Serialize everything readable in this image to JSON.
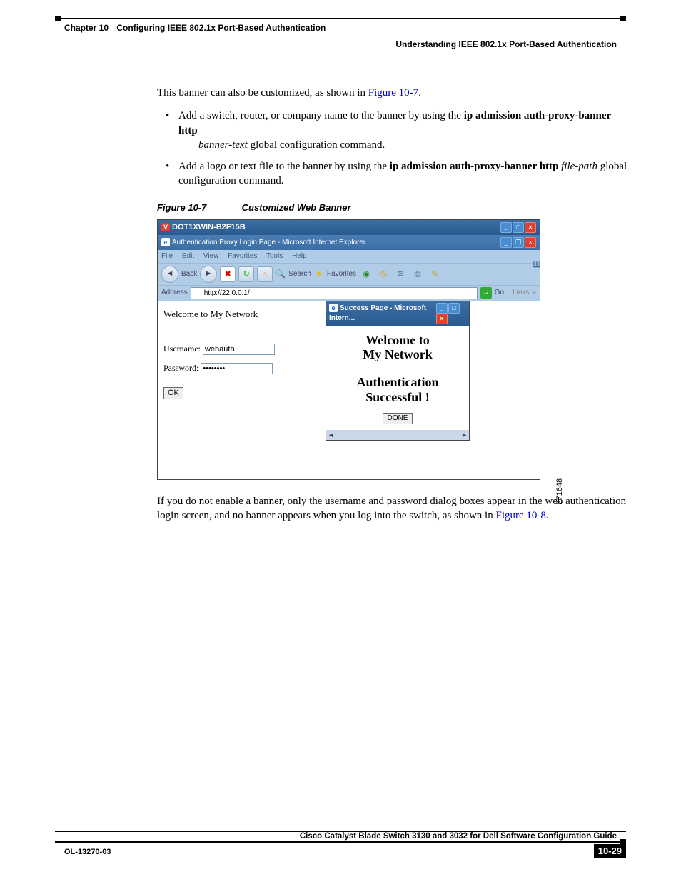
{
  "header": {
    "chapter_num": "Chapter 10",
    "chapter_title": "Configuring IEEE 802.1x Port-Based Authentication",
    "section_title": "Understanding IEEE 802.1x Port-Based Authentication"
  },
  "body": {
    "intro": "This banner can also be customized, as shown in ",
    "intro_link": "Figure 10-7",
    "intro_end": ".",
    "bullet1_a": "Add a switch, router, or company name to the banner by using the ",
    "bullet1_b": "ip admission auth-proxy-banner http",
    "bullet1_c": "banner-text",
    "bullet1_d": " global configuration command.",
    "bullet2_a": "Add a logo or text file to the banner by using the ",
    "bullet2_b": "ip admission auth-proxy-banner http",
    "bullet2_c": "file-path",
    "bullet2_d": " global configuration command.",
    "figcap_num": "Figure 10-7",
    "figcap_title": "Customized Web Banner",
    "after1": "If you do not enable a banner, only the username and password dialog boxes appear in the web authentication login screen, and no banner appears when you log into the switch, as shown in ",
    "after_link": "Figure 10-8",
    "after_end": "."
  },
  "browser": {
    "app_title": "DOT1XWIN-B2F15B",
    "doc_title": "Authentication Proxy Login Page - Microsoft Internet Explorer",
    "menu": {
      "file": "File",
      "edit": "Edit",
      "view": "View",
      "favorites": "Favorites",
      "tools": "Tools",
      "help": "Help"
    },
    "toolbar": {
      "back": "Back",
      "search": "Search",
      "favorites": "Favorites"
    },
    "address_label": "Address",
    "address_value": "http://22.0.0.1/",
    "go": "Go",
    "links": "Links",
    "page": {
      "welcome": "Welcome to My Network",
      "username_label": "Username:",
      "username_value": "webauth",
      "password_label": "Password:",
      "password_value": "••••••••",
      "ok": "OK"
    },
    "popup": {
      "title": "Success Page - Microsoft Intern...",
      "line1": "Welcome to",
      "line2": "My Network",
      "line3": "Authentication",
      "line4": "Successful !",
      "done": "DONE"
    },
    "side_label": "271648"
  },
  "footer": {
    "guide": "Cisco Catalyst Blade Switch 3130 and 3032 for Dell Software Configuration Guide",
    "ol": "OL-13270-03",
    "pagenum": "10-29"
  }
}
